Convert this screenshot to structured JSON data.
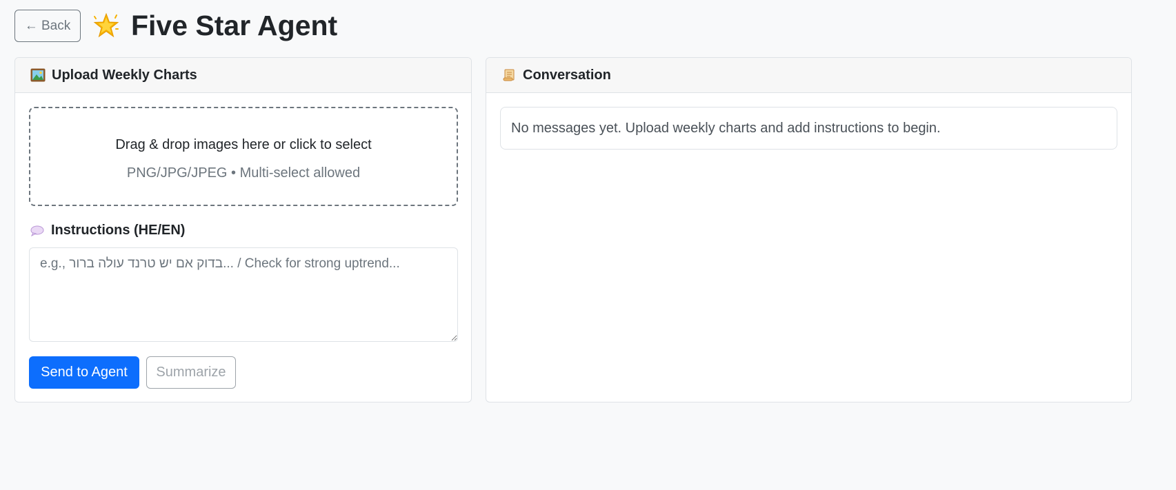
{
  "header": {
    "back_label": "← Back",
    "title": "Five Star Agent",
    "title_icon": "star-icon"
  },
  "upload_panel": {
    "title": "Upload Weekly Charts",
    "title_icon": "framed-picture-icon",
    "dropzone": {
      "title": "Drag & drop images here or click to select",
      "subtitle": "PNG/JPG/JPEG • Multi-select allowed"
    },
    "instructions": {
      "label": "Instructions (HE/EN)",
      "label_icon": "speech-balloon-icon",
      "value": "",
      "placeholder": "e.g., בדוק אם יש טרנד עולה ברור... / Check for strong uptrend..."
    },
    "send_label": "Send to Agent",
    "summarize_label": "Summarize"
  },
  "conversation_panel": {
    "title": "Conversation",
    "title_icon": "scroll-icon",
    "empty_message": "No messages yet. Upload weekly charts and add instructions to begin."
  },
  "colors": {
    "primary": "#0d6efd",
    "background": "#f8f9fa",
    "border": "#dee2e6",
    "muted": "#6c757d"
  }
}
